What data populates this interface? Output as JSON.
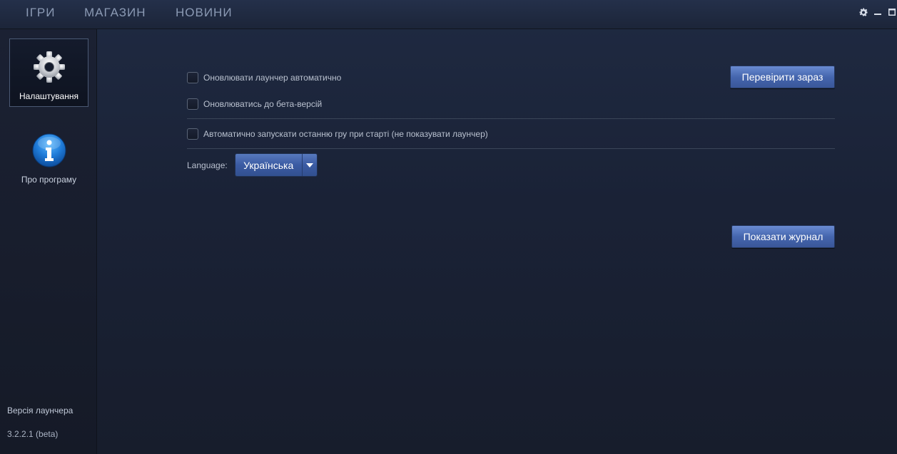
{
  "nav": {
    "items": [
      {
        "label": "ІГРИ"
      },
      {
        "label": "МАГАЗИН"
      },
      {
        "label": "НОВИНИ"
      }
    ]
  },
  "window_controls": {
    "icons": [
      "gear-icon",
      "minimize-icon",
      "maximize-icon"
    ]
  },
  "sidebar": {
    "items": [
      {
        "label": "Налаштування",
        "icon": "gear-icon",
        "active": true
      },
      {
        "label": "Про програму",
        "icon": "info-icon",
        "active": false
      }
    ],
    "version_label": "Версія лаунчера",
    "version_value": "3.2.2.1 (beta)"
  },
  "settings": {
    "auto_update": {
      "label": "Оновлювати лаунчер автоматично",
      "checked": false
    },
    "beta_updates": {
      "label": "Оновлюватись до бета-версій",
      "checked": false
    },
    "auto_launch": {
      "label": "Автоматично запускати останню гру при старті (не показувати лаунчер)",
      "checked": false
    },
    "check_now_label": "Перевірити зараз",
    "language_label": "Language:",
    "language_value": "Українська",
    "show_log_label": "Показати журнал"
  },
  "colors": {
    "accent": "#4566ae",
    "background": "#1a2236",
    "text": "#b9c1cf"
  }
}
